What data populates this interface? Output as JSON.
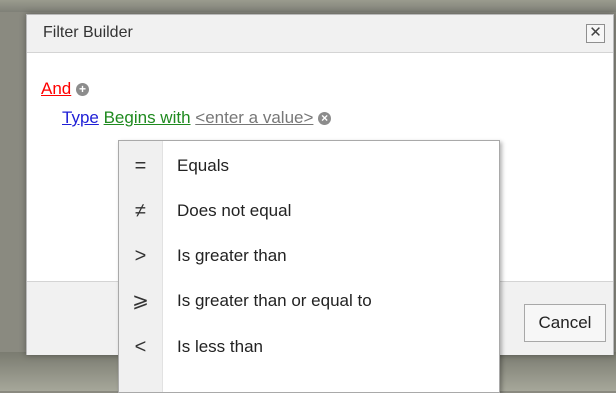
{
  "dialog": {
    "title": "Filter Builder",
    "close_glyph": "✕",
    "cancel_label": "Cancel"
  },
  "filter": {
    "group_operator": "And",
    "field": "Type",
    "operation": "Begins with",
    "value_placeholder": "<enter a value>",
    "add_icon": "plus-circle-icon",
    "remove_icon": "remove-circle-icon"
  },
  "menu": {
    "items": [
      {
        "label": "Equals",
        "icon": "equals-icon",
        "glyph": "="
      },
      {
        "label": "Does not equal",
        "icon": "not-equal-icon",
        "glyph": "≠"
      },
      {
        "label": "Is greater than",
        "icon": "greater-than-icon",
        "glyph": ">"
      },
      {
        "label": "Is greater than or equal to",
        "icon": "greater-or-equal-icon",
        "glyph": "⩾"
      },
      {
        "label": "Is less than",
        "icon": "less-than-icon",
        "glyph": "<"
      }
    ]
  },
  "colors": {
    "group_operator": "#ff0000",
    "field": "#1f1fd6",
    "operation": "#1f8a1f",
    "placeholder": "#777777"
  }
}
